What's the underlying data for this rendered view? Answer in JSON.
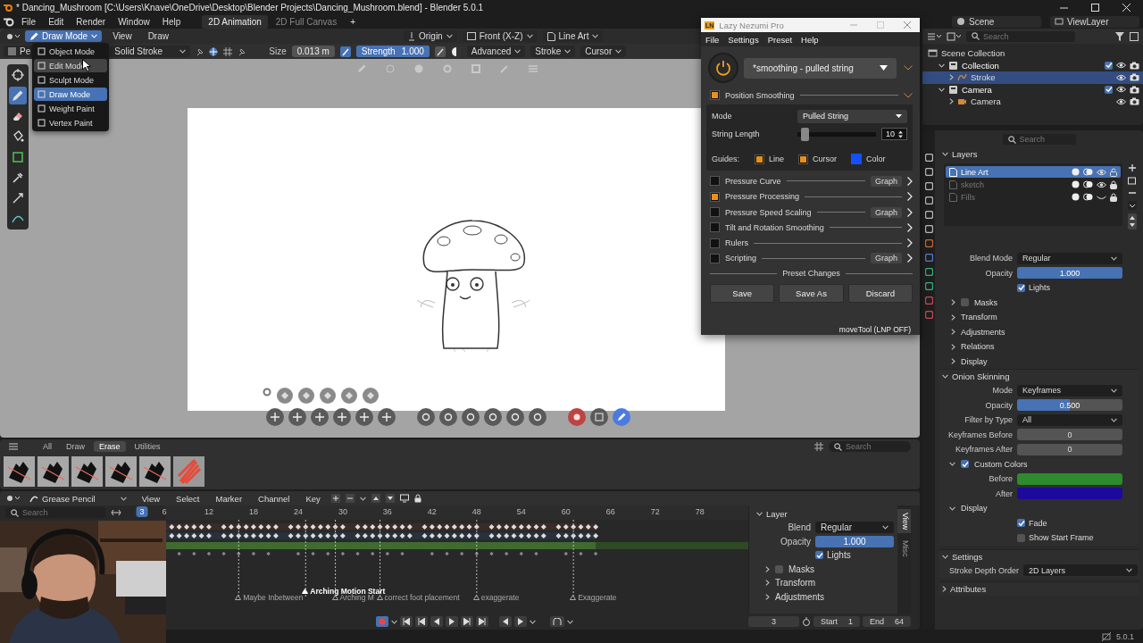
{
  "title_bar": {
    "title": "* Dancing_Mushroom [C:\\Users\\Knave\\OneDrive\\Desktop\\Blender Projects\\Dancing_Mushroom.blend] - Blender 5.0.1"
  },
  "menu": [
    "File",
    "Edit",
    "Render",
    "Window",
    "Help"
  ],
  "workspaces": [
    {
      "label": "2D Animation",
      "selected": true
    },
    {
      "label": "2D Full Canvas",
      "selected": false
    }
  ],
  "add_workspace": "+",
  "scene": "Scene",
  "view_layer": "ViewLayer",
  "viewport": {
    "mode": "Draw Mode",
    "menus": [
      "View",
      "Draw"
    ],
    "pivot": "Origin",
    "view": "Front (X-Z)",
    "layer": "Line Art",
    "brush": "Pe",
    "stroke_type": "Solid Stroke",
    "size_label": "Size",
    "size": "0.013 m",
    "strength": {
      "label": "Strength",
      "value": "1.000",
      "level": 1
    },
    "popovers": [
      "Advanced",
      "Stroke",
      "Cursor"
    ],
    "tools": [
      {
        "kind": "cursor",
        "selected": false
      },
      {
        "kind": "draw",
        "selected": true
      },
      {
        "kind": "erase",
        "selected": false
      },
      {
        "kind": "fill",
        "selected": false
      },
      {
        "kind": "box",
        "selected": false
      },
      {
        "kind": "eyedropper",
        "selected": false
      },
      {
        "kind": "transform",
        "selected": false
      },
      {
        "kind": "curve",
        "selected": false
      }
    ]
  },
  "mode_menu": [
    {
      "label": "Object Mode",
      "selected": false,
      "hovered": false
    },
    {
      "label": "Edit Mode",
      "selected": false,
      "hovered": true
    },
    {
      "label": "Sculpt Mode",
      "selected": false,
      "hovered": false
    },
    {
      "label": "Draw Mode",
      "selected": true,
      "hovered": false
    },
    {
      "label": "Weight Paint",
      "selected": false,
      "hovered": false
    },
    {
      "label": "Vertex Paint",
      "selected": false,
      "hovered": false
    }
  ],
  "lazy_nezumi": {
    "title": "Lazy Nezumi Pro",
    "logo": "LN",
    "menu": [
      "File",
      "Settings",
      "Preset",
      "Help"
    ],
    "on": true,
    "preset": "*smoothing - pulled string",
    "smoothing": {
      "label": "Position Smoothing",
      "checked": true,
      "mode_label": "Mode",
      "mode": "Pulled String",
      "length_label": "String Length",
      "level": 0.05,
      "length": "10",
      "guides_label": "Guides:",
      "guides": [
        {
          "label": "Line",
          "checked": true
        },
        {
          "label": "Cursor",
          "checked": true
        }
      ],
      "color_label": "Color",
      "color": "#1450ff"
    },
    "sections": [
      {
        "label": "Pressure Curve",
        "checked": false,
        "graph": "Graph"
      },
      {
        "label": "Pressure Processing",
        "checked": true
      },
      {
        "label": "Pressure Speed Scaling",
        "checked": false,
        "graph": "Graph"
      },
      {
        "label": "Tilt and Rotation Smoothing",
        "checked": false
      },
      {
        "label": "Rulers",
        "checked": false
      },
      {
        "label": "Scripting",
        "checked": false,
        "graph": "Graph"
      }
    ],
    "preset_changes": "Preset Changes",
    "buttons": [
      "Save",
      "Save As",
      "Discard"
    ],
    "status": "moveTool (LNP OFF)"
  },
  "outliner": {
    "search_placeholder": "Search",
    "tree": [
      {
        "label": "Scene Collection",
        "kind": "scene",
        "selected": false,
        "children": [
          {
            "label": "Collection",
            "kind": "collection",
            "selected": false,
            "checked": true,
            "children": [
              {
                "label": "Stroke",
                "kind": "stroke",
                "selected": true
              }
            ]
          },
          {
            "label": "Camera",
            "kind": "collection",
            "selected": false,
            "checked": true,
            "children": [
              {
                "label": "Camera",
                "kind": "camera",
                "selected": false
              }
            ]
          }
        ]
      }
    ]
  },
  "properties": {
    "search_placeholder": "Search",
    "layers_label": "Layers",
    "layers": [
      {
        "name": "Line Art",
        "selected": true,
        "dimmed": false,
        "visible": true,
        "locked": false
      },
      {
        "name": "sketch",
        "selected": false,
        "dimmed": true,
        "visible": true,
        "locked": true
      },
      {
        "name": "Fills",
        "selected": false,
        "dimmed": true,
        "visible": false,
        "locked": true
      }
    ],
    "layer_fields": [
      {
        "kind": "dropdown",
        "label": "Blend Mode",
        "value": "Regular"
      },
      {
        "kind": "slider",
        "label": "Opacity",
        "value": "1.000",
        "level": 1
      },
      {
        "kind": "check",
        "label": "Lights",
        "checked": true
      }
    ],
    "subpanels": [
      {
        "label": "Masks",
        "kind": "check",
        "checked": false
      },
      {
        "label": "Transform",
        "kind": "plain"
      },
      {
        "label": "Adjustments",
        "kind": "plain"
      },
      {
        "label": "Relations",
        "kind": "plain"
      },
      {
        "label": "Display",
        "kind": "plain"
      }
    ],
    "onion_label": "Onion Skinning",
    "onion_fields": [
      {
        "kind": "dropdown",
        "label": "Mode",
        "value": "Keyframes"
      },
      {
        "kind": "slider",
        "label": "Opacity",
        "value": "0.500",
        "level": 0.5
      },
      {
        "kind": "dropdown",
        "label": "Filter by Type",
        "value": "All"
      },
      {
        "kind": "number",
        "label": "Keyframes Before",
        "value": "0"
      },
      {
        "kind": "number",
        "label": "Keyframes After",
        "value": "0"
      }
    ],
    "custom_colors": {
      "label": "Custom Colors",
      "checked": true,
      "colors": [
        {
          "label": "Before",
          "color": "#2d8a2d"
        },
        {
          "label": "After",
          "color": "#1c0a9c"
        }
      ]
    },
    "display_label": "Display",
    "display_fields": [
      {
        "kind": "check",
        "label": "Fade",
        "checked": true
      },
      {
        "kind": "check",
        "label": "Show Start Frame",
        "checked": false
      }
    ],
    "settings_label": "Settings",
    "settings_fields": [
      {
        "kind": "dropdown",
        "label": "Stroke Depth Order",
        "value": "2D Layers"
      }
    ],
    "attributes_label": "Attributes"
  },
  "asset_shelf": {
    "tabs": [
      {
        "label": "All",
        "selected": false
      },
      {
        "label": "Draw",
        "selected": false
      },
      {
        "label": "Erase",
        "selected": true
      },
      {
        "label": "Utilities",
        "selected": false
      }
    ],
    "search_placeholder": "Search"
  },
  "dopesheet": {
    "mode": "Grease Pencil",
    "menus": [
      "View",
      "Select",
      "Marker",
      "Channel",
      "Key"
    ],
    "search_placeholder": "Search",
    "current_frame": "3",
    "frames": [
      "6",
      "12",
      "18",
      "24",
      "30",
      "36",
      "42",
      "48",
      "54",
      "60",
      "66",
      "72",
      "78"
    ],
    "markers": [
      {
        "label": "Maybe Inbetween",
        "selected": false
      },
      {
        "label": "Arching Motion Start",
        "selected": true
      },
      {
        "label": "Arching M",
        "selected": false
      },
      {
        "label": "correct foot placement",
        "selected": false
      },
      {
        "label": "exaggerate",
        "selected": false
      },
      {
        "label": "Exaggerate",
        "selected": false
      }
    ],
    "sidebar": {
      "panel": "Layer",
      "fields": [
        {
          "kind": "dropdown",
          "label": "Blend",
          "value": "Regular"
        },
        {
          "kind": "slider",
          "label": "Opacity",
          "value": "1.000",
          "level": 1
        },
        {
          "kind": "check",
          "label": "Lights",
          "checked": true
        }
      ],
      "subpanels": [
        {
          "label": "Masks",
          "kind": "check",
          "checked": false
        },
        {
          "label": "Transform",
          "kind": "plain"
        },
        {
          "label": "Adjustments",
          "kind": "plain"
        }
      ],
      "tabs": [
        {
          "label": "View",
          "selected": true
        },
        {
          "label": "Misc",
          "selected": false
        }
      ]
    },
    "playback": {
      "current": "3",
      "start_label": "Start",
      "start": "1",
      "end_label": "End",
      "end": "64"
    }
  },
  "status_bar": {
    "version": "5.0.1"
  }
}
